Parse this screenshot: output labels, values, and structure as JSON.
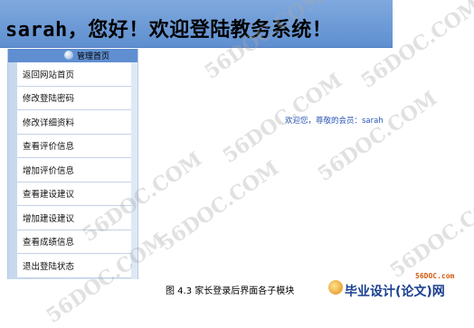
{
  "banner": {
    "title": "sarah，您好！欢迎登陆教务系统！"
  },
  "sidebar": {
    "header": "管理首页",
    "items": [
      {
        "label": "返回网站首页"
      },
      {
        "label": "修改登陆密码"
      },
      {
        "label": "修改详细资料"
      },
      {
        "label": "查看评价信息"
      },
      {
        "label": "增加评价信息"
      },
      {
        "label": "查看建设建议"
      },
      {
        "label": "增加建设建议"
      },
      {
        "label": "查看成绩信息"
      },
      {
        "label": "退出登陆状态"
      }
    ]
  },
  "main": {
    "welcome": "欢迎您，尊敬的会员：sarah"
  },
  "caption": "图 4.3 家长登录后界面各子模块",
  "logo": {
    "url": "56DOC.com",
    "text": "毕业设计(论文)网"
  },
  "watermark": "56DOC.COM",
  "colors": {
    "banner": "#5f8fd0",
    "sidebar_bg": "#c7d8ee",
    "welcome_text": "#2b55b5"
  }
}
